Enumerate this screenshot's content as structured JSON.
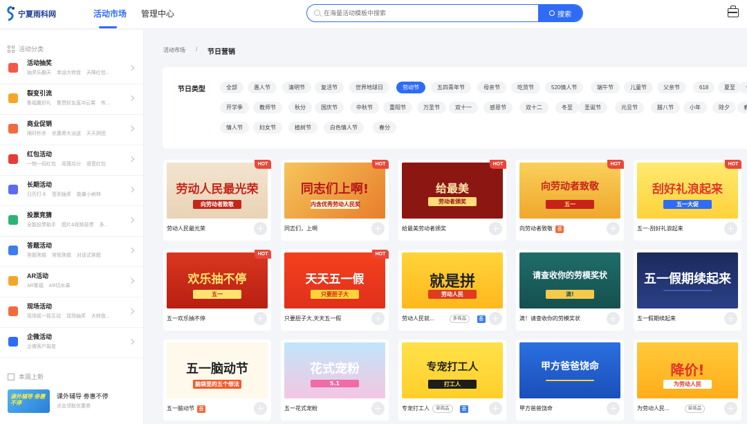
{
  "brand": {
    "name": "宁夏雨科网"
  },
  "nav": {
    "tabs": [
      {
        "label": "活动市场",
        "active": true
      },
      {
        "label": "管理中心",
        "active": false
      }
    ]
  },
  "search": {
    "placeholder": "在海量活动模板中搜索",
    "button": "搜索"
  },
  "sidebar": {
    "heading": "活动分类",
    "items": [
      {
        "title": "活动抽奖",
        "sub": "抽奖乐翻天 幸运大转盘 天降红包...",
        "icon": "gift-icon",
        "color": "#f4574a"
      },
      {
        "title": "裂变引流",
        "sub": "集福赢好礼 集赞好友直冲云霄 传...",
        "icon": "user-icon",
        "color": "#f7a52a"
      },
      {
        "title": "商业促销",
        "sub": "限时秒杀 优惠券大派送 天天拼团",
        "icon": "tag-icon",
        "color": "#f36a3d"
      },
      {
        "title": "红包活动",
        "sub": "一物一码红包 竞猜瓜分 语音红包",
        "icon": "envelope-icon",
        "color": "#ea3b3b"
      },
      {
        "title": "长期活动",
        "sub": "日历打卡 签到抽奖 能量小树林",
        "icon": "calendar-icon",
        "color": "#5a6cf0"
      },
      {
        "title": "投票竞猜",
        "sub": "全能投票助手 图片&视频投票 多...",
        "icon": "vote-icon",
        "color": "#2bb573"
      },
      {
        "title": "答题活动",
        "sub": "答题答题 常规答题 对话式答题",
        "icon": "question-icon",
        "color": "#3a7ef0"
      },
      {
        "title": "AR活动",
        "sub": "AR集福 AR切水果",
        "icon": "robot-icon",
        "color": "#f7a52a"
      },
      {
        "title": "现场活动",
        "sub": "现场摇一摇互动 现场抽奖 大转盘...",
        "icon": "screen-icon",
        "color": "#f36a3d"
      },
      {
        "title": "企微活动",
        "sub": "企微客户裂变",
        "icon": "wecom-icon",
        "color": "#2f6cf6"
      }
    ],
    "new_heading": "本周上新",
    "news": {
      "thumb_text": "课外辅导 劵惠不停",
      "title": "课外辅导 劵惠不停",
      "sub": "点击领取优惠券"
    }
  },
  "breadcrumb": {
    "root": "活动市场",
    "sep": "/",
    "current": "节日营销"
  },
  "filter": {
    "label": "节日类型",
    "rows": [
      [
        "全部",
        "愚人节",
        "清明节",
        "复活节",
        "世界地球日",
        "劳动节",
        "五四青年节",
        "母亲节",
        "吃货节",
        "520情人节",
        "端午节",
        "儿童节",
        "父亲节",
        "618",
        "夏至",
        "七"
      ],
      [
        "开学季",
        "教师节",
        "秋分",
        "国庆节",
        "中秋节",
        "重阳节",
        "万圣节",
        "双十一",
        "感恩节",
        "双十二",
        "冬至",
        "圣诞节",
        "元旦节",
        "腊八节",
        "小年",
        "除夕",
        "春"
      ],
      [
        "情人节",
        "妇女节",
        "植树节",
        "白色情人节",
        "春分"
      ]
    ],
    "selected": "劳动节"
  },
  "cards": [
    {
      "title": "劳动人民最光荣",
      "hot": true,
      "art": "劳动人民最光荣",
      "art_sub": "向劳动者致敬"
    },
    {
      "title": "同志们，上啊",
      "hot": true,
      "art": "同志们上啊!",
      "art_sub": "内含优秀劳动人民奖"
    },
    {
      "title": "给最美劳动者颁奖",
      "hot": true,
      "art": "给最美",
      "art_sub": "劳动者颁奖"
    },
    {
      "title": "向劳动者致敬",
      "hot": true,
      "vip": "荟",
      "art": "向劳动者致敬",
      "art_sub": "五一"
    },
    {
      "title": "五一-刮好礼浪起来",
      "hot": true,
      "art": "刮好礼浪起来",
      "art_sub": "五一大促"
    },
    {
      "title": "五一欢乐抽不停",
      "hot": true,
      "art": "欢乐抽不停",
      "art_sub": "五一"
    },
    {
      "title": "只要胆子大,天天五一假",
      "hot": true,
      "art": "天天五一假",
      "art_sub": "只要胆子大"
    },
    {
      "title": "劳动人民就...",
      "pill": "多商品",
      "vip": "荟",
      "art": "就是拼",
      "art_sub": "劳动人民"
    },
    {
      "title": "滴！请查收你的劳模奖状",
      "art": "请查收你的劳模奖状",
      "art_sub": "滴!"
    },
    {
      "title": "五一假期续起来",
      "art": "五一假期续起来",
      "art_sub": ""
    },
    {
      "title": "五一脑动节",
      "vip": "荟",
      "art": "五一脑动节",
      "art_sub": "脑袋里的五个想法"
    },
    {
      "title": "五一花式宠粉",
      "art": "花式宠粉",
      "art_sub": "5.1"
    },
    {
      "title": "专宠打工人",
      "pill": "单商品",
      "vip": "荟",
      "art": "专宠打工人",
      "art_sub": "打工人"
    },
    {
      "title": "甲方爸爸饶命",
      "art": "甲方爸爸饶命",
      "art_sub": ""
    },
    {
      "title": "为劳动人民...",
      "pill": "单商品",
      "art": "降价!",
      "art_sub": "为劳动人民"
    }
  ]
}
